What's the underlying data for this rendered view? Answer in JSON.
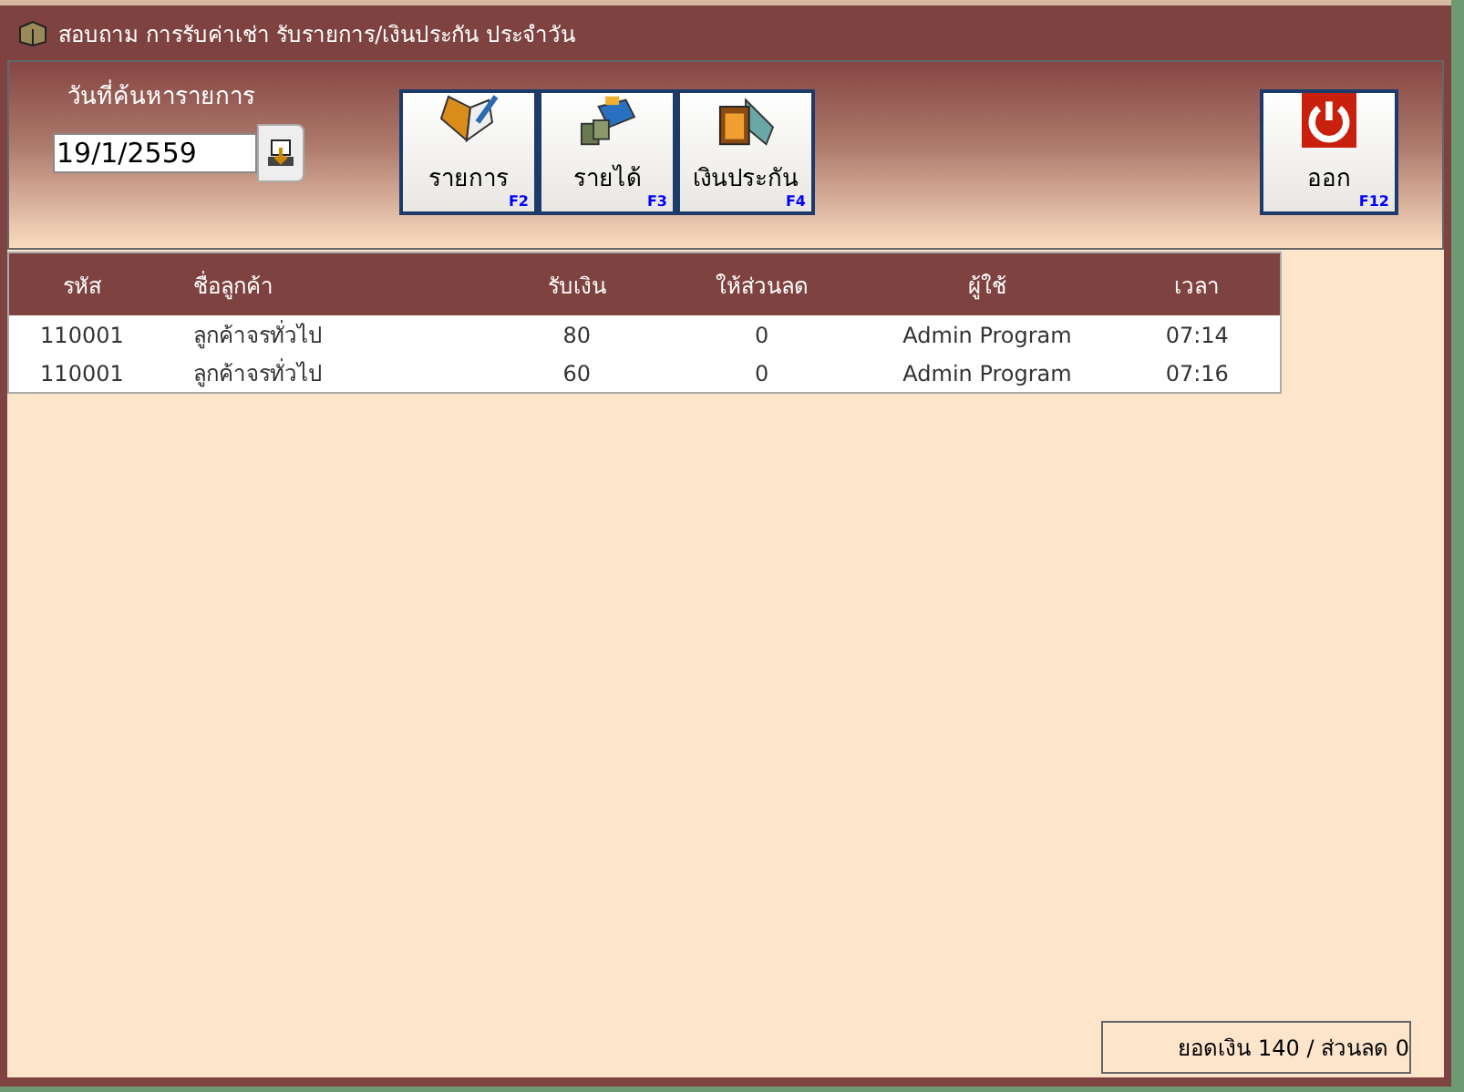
{
  "window": {
    "title": "สอบถาม การรับค่าเช่า รับรายการ/เงินประกัน ประจำวัน"
  },
  "search": {
    "label": "วันที่ค้นหารายการ",
    "value": "19/1/2559"
  },
  "buttons": [
    {
      "kind": "list",
      "label": "รายการ",
      "key": "F2"
    },
    {
      "kind": "income",
      "label": "รายได้",
      "key": "F3"
    },
    {
      "kind": "deposit",
      "label": "เงินประกัน",
      "key": "F4"
    }
  ],
  "exit_button": {
    "kind": "power",
    "label": "ออก",
    "key": "F12"
  },
  "table": {
    "columns": [
      "รหัส",
      "ชื่อลูกค้า",
      "รับเงิน",
      "ให้ส่วนลด",
      "ผู้ใช้",
      "เวลา"
    ],
    "rows": [
      [
        "110001",
        "ลูกค้าจรทั่วไป",
        "80",
        "0",
        "Admin Program",
        "07:14"
      ],
      [
        "110001",
        "ลูกค้าจรทั่วไป",
        "60",
        "0",
        "Admin Program",
        "07:16"
      ]
    ]
  },
  "status_bar": {
    "total": "ยอดเงิน 140 / ส่วนลด 0"
  }
}
